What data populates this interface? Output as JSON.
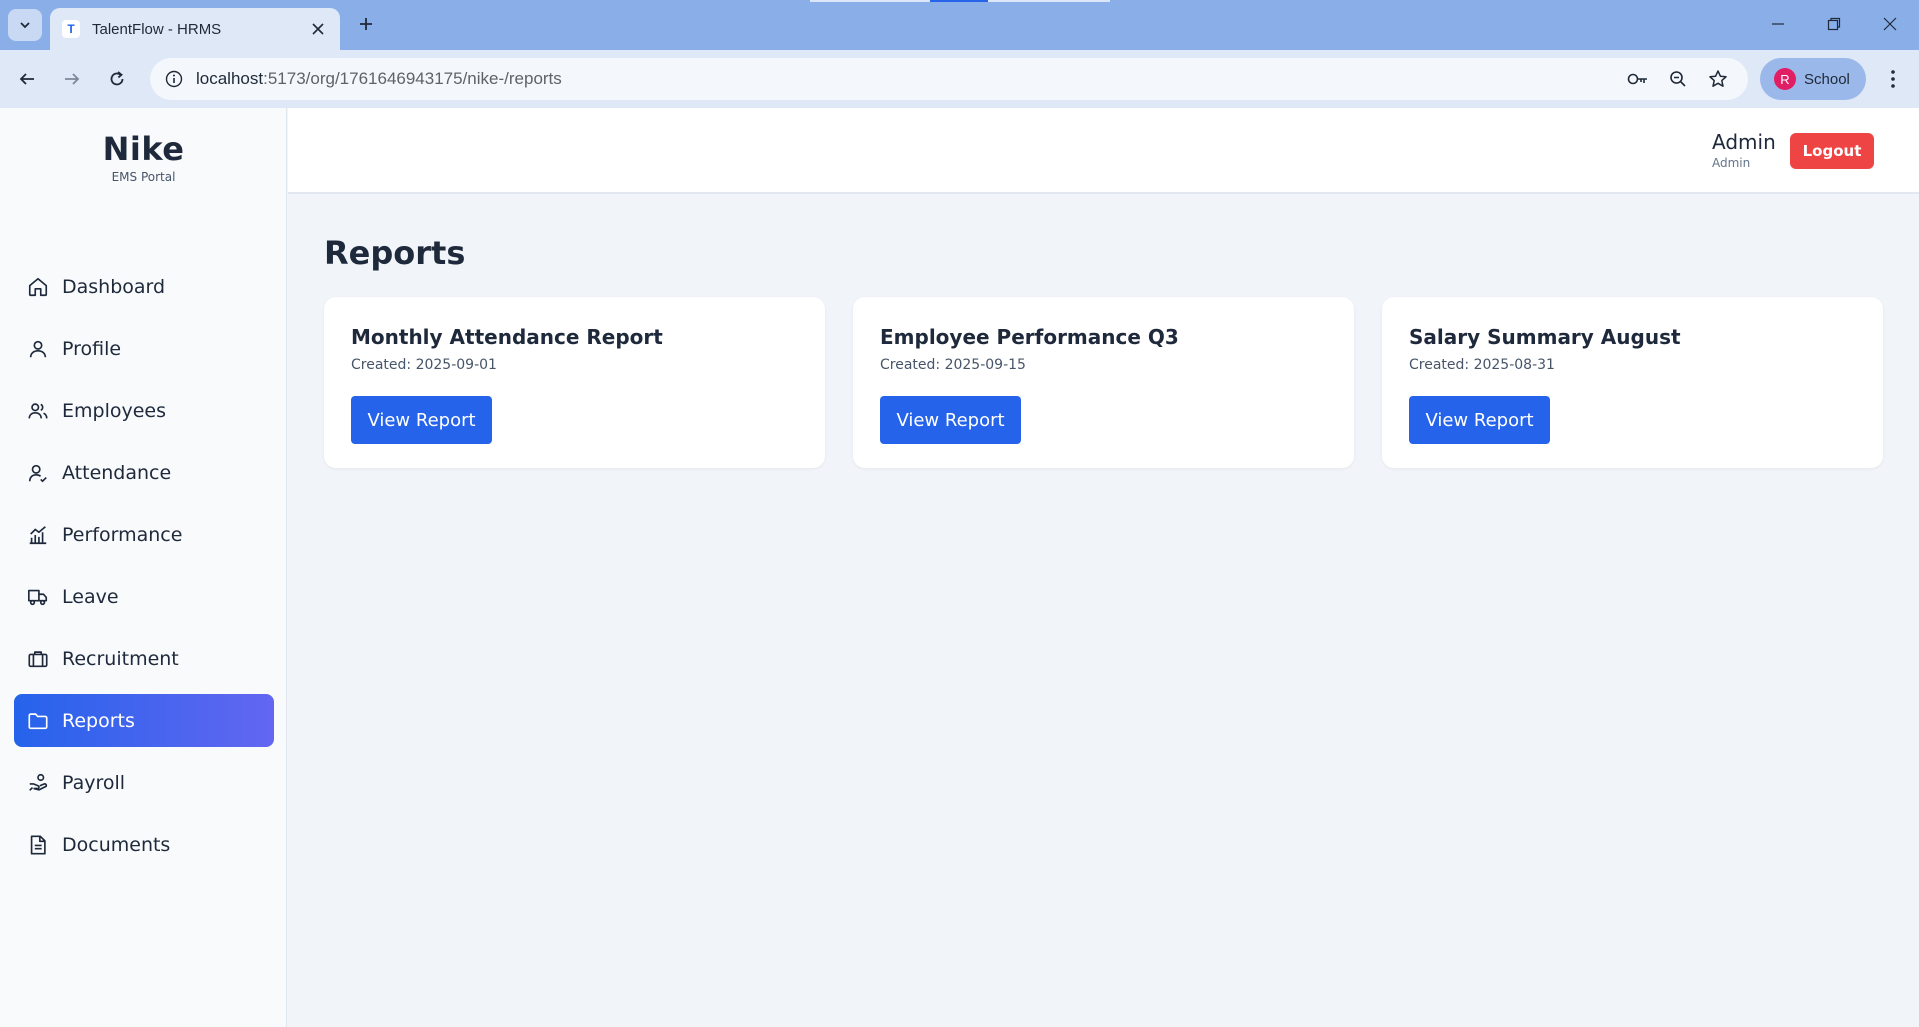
{
  "browser": {
    "tab_title": "TalentFlow - HRMS",
    "favicon_letter": "T",
    "url_host": "localhost",
    "url_path": ":5173/org/1761646943175/nike-/reports",
    "profile_initial": "R",
    "profile_name": "School"
  },
  "sidebar": {
    "brand": "Nike",
    "subtitle": "EMS Portal",
    "items": [
      {
        "label": "Dashboard",
        "icon": "home-icon"
      },
      {
        "label": "Profile",
        "icon": "user-icon"
      },
      {
        "label": "Employees",
        "icon": "users-icon"
      },
      {
        "label": "Attendance",
        "icon": "user-check-icon"
      },
      {
        "label": "Performance",
        "icon": "chart-icon"
      },
      {
        "label": "Leave",
        "icon": "truck-icon"
      },
      {
        "label": "Recruitment",
        "icon": "briefcase-icon"
      },
      {
        "label": "Reports",
        "icon": "folder-icon",
        "active": true
      },
      {
        "label": "Payroll",
        "icon": "hand-coins-icon"
      },
      {
        "label": "Documents",
        "icon": "document-icon"
      }
    ]
  },
  "header": {
    "user_name": "Admin",
    "user_role": "Admin",
    "logout_label": "Logout"
  },
  "main": {
    "title": "Reports",
    "reports": [
      {
        "title": "Monthly Attendance Report",
        "created": "Created: 2025-09-01",
        "button": "View Report"
      },
      {
        "title": "Employee Performance Q3",
        "created": "Created: 2025-09-15",
        "button": "View Report"
      },
      {
        "title": "Salary Summary August",
        "created": "Created: 2025-08-31",
        "button": "View Report"
      }
    ]
  },
  "colors": {
    "accent": "#2563eb",
    "accent_gradient_end": "#6366f1",
    "danger": "#ef4444",
    "text": "#1e293b"
  }
}
